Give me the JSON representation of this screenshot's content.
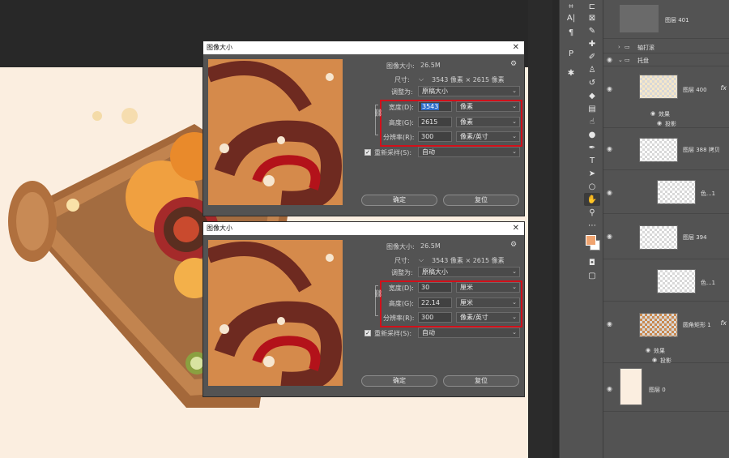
{
  "dialogs": [
    {
      "title": "图像大小",
      "image_size_label": "图像大小:",
      "image_size_value": "26.5M",
      "dimensions_label": "尺寸:",
      "dimensions_value": "3543 像素 × 2615 像素",
      "fit_to_label": "调整为:",
      "fit_to_value": "原稿大小",
      "width_label": "宽度(D):",
      "width_value": "3543",
      "width_unit": "像素",
      "height_label": "高度(G):",
      "height_value": "2615",
      "height_unit": "像素",
      "resolution_label": "分辨率(R):",
      "resolution_value": "300",
      "resolution_unit": "像素/英寸",
      "resample_label": "重新采样(S):",
      "resample_value": "自动",
      "ok_label": "确定",
      "reset_label": "复位"
    },
    {
      "title": "图像大小",
      "image_size_label": "图像大小:",
      "image_size_value": "26.5M",
      "dimensions_label": "尺寸:",
      "dimensions_value": "3543 像素 × 2615 像素",
      "fit_to_label": "调整为:",
      "fit_to_value": "原稿大小",
      "width_label": "宽度(D):",
      "width_value": "30",
      "width_unit": "厘米",
      "height_label": "高度(G):",
      "height_value": "22.14",
      "height_unit": "厘米",
      "resolution_label": "分辨率(R):",
      "resolution_value": "300",
      "resolution_unit": "像素/英寸",
      "resample_label": "重新采样(S):",
      "resample_value": "自动",
      "ok_label": "确定",
      "reset_label": "复位"
    }
  ],
  "layers": {
    "layer_401": "图层 401",
    "group_1": "轴打滚",
    "group_2": "托盘",
    "layer_400": "图层 400",
    "effects_label": "效果",
    "drop_shadow_label": "投影",
    "layer_388_copy": "图层 388 拷贝",
    "color_1": "色...1",
    "layer_394": "图层 394",
    "color_2": "色...1",
    "rounded_rect": "圆角矩形 1",
    "background": "图层 0",
    "fx_label": "fx"
  },
  "colors": {
    "highlight_red": "#d1101a",
    "foreground_swatch": "#f0a470",
    "selection_blue": "#2e6ec9"
  }
}
